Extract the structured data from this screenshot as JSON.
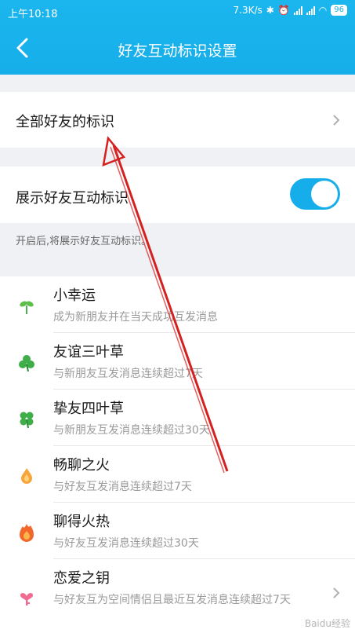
{
  "status_bar": {
    "time": "上午10:18",
    "speed": "7.3K/s",
    "battery": "96"
  },
  "header": {
    "title": "好友互动标识设置"
  },
  "all_friends": {
    "label": "全部好友的标识"
  },
  "show_toggle": {
    "label": "展示好友互动标识",
    "checked": true
  },
  "hint": "开启后,将展示好友互动标识。",
  "badges": [
    {
      "name": "小幸运",
      "desc": "成为新朋友并在当天成功互发消息",
      "icon": "sprout-icon"
    },
    {
      "name": "友谊三叶草",
      "desc": "与新朋友互发消息连续超过7天",
      "icon": "three-leaf-clover-icon"
    },
    {
      "name": "挚友四叶草",
      "desc": "与新朋友互发消息连续超过30天",
      "icon": "four-leaf-clover-icon"
    },
    {
      "name": "畅聊之火",
      "desc": "与好友互发消息连续超过7天",
      "icon": "small-flame-icon"
    },
    {
      "name": "聊得火热",
      "desc": "与好友互发消息连续超过30天",
      "icon": "big-flame-icon"
    },
    {
      "name": "恋爱之钥",
      "desc": "与好友互为空间情侣且最近互发消息连续超过7天",
      "icon": "key-icon"
    }
  ],
  "watermark": "Baidu经验"
}
